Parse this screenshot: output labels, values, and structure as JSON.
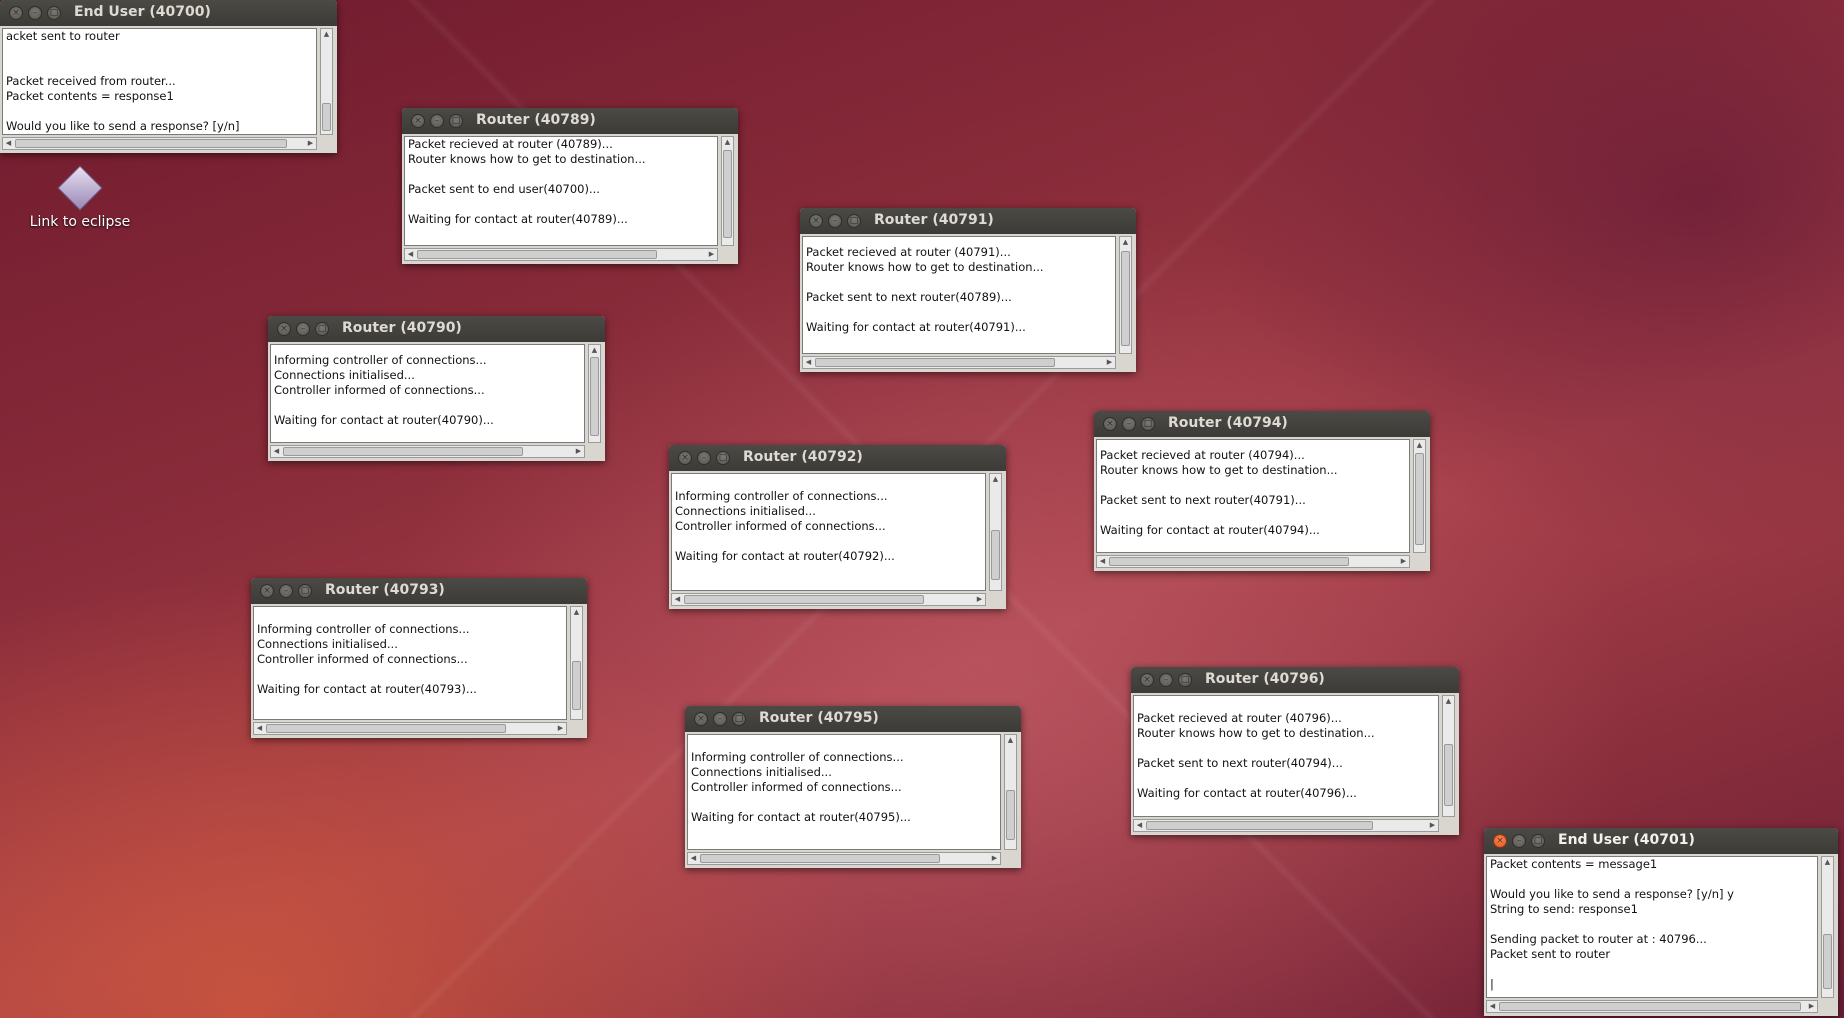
{
  "desktop": {
    "icon_label": "Link to eclipse"
  },
  "windows": [
    {
      "title": "End User (40700)",
      "lines": [
        "acket sent to router",
        "",
        "",
        "Packet received from router...",
        "Packet contents = response1",
        "",
        "Would you like to send a response? [y/n]"
      ]
    },
    {
      "title": "Router (40789)",
      "lines": [
        "Packet recieved at router (40789)...",
        "Router knows how to get to destination...",
        "",
        "Packet sent to end user(40700)...",
        "",
        "Waiting for contact at router(40789)..."
      ]
    },
    {
      "title": "Router (40791)",
      "lines": [
        "Packet recieved at router (40791)...",
        "Router knows how to get to destination...",
        "",
        "Packet sent to next router(40789)...",
        "",
        "Waiting for contact at router(40791)..."
      ]
    },
    {
      "title": "Router (40790)",
      "lines": [
        "Informing controller of connections...",
        "Connections initialised...",
        "Controller informed of connections...",
        "",
        "Waiting for contact at router(40790)..."
      ]
    },
    {
      "title": "Router (40794)",
      "lines": [
        "Packet recieved at router (40794)...",
        "Router knows how to get to destination...",
        "",
        "Packet sent to next router(40791)...",
        "",
        "Waiting for contact at router(40794)..."
      ]
    },
    {
      "title": "Router (40792)",
      "lines": [
        "",
        "Informing controller of connections...",
        "Connections initialised...",
        "Controller informed of connections...",
        "",
        "Waiting for contact at router(40792)..."
      ]
    },
    {
      "title": "Router (40793)",
      "lines": [
        "",
        "Informing controller of connections...",
        "Connections initialised...",
        "Controller informed of connections...",
        "",
        "Waiting for contact at router(40793)..."
      ]
    },
    {
      "title": "Router (40795)",
      "lines": [
        "",
        "Informing controller of connections...",
        "Connections initialised...",
        "Controller informed of connections...",
        "",
        "Waiting for contact at router(40795)..."
      ]
    },
    {
      "title": "Router (40796)",
      "lines": [
        "",
        "Packet recieved at router (40796)...",
        "Router knows how to get to destination...",
        "",
        "Packet sent to next router(40794)...",
        "",
        "Waiting for contact at router(40796)..."
      ]
    },
    {
      "title": "End User (40701)",
      "lines": [
        "Packet contents = message1",
        "",
        "Would you like to send a response? [y/n] y",
        "String to send: response1",
        "",
        "Sending packet to router at : 40796...",
        "Packet sent to router",
        "",
        "|"
      ]
    }
  ]
}
